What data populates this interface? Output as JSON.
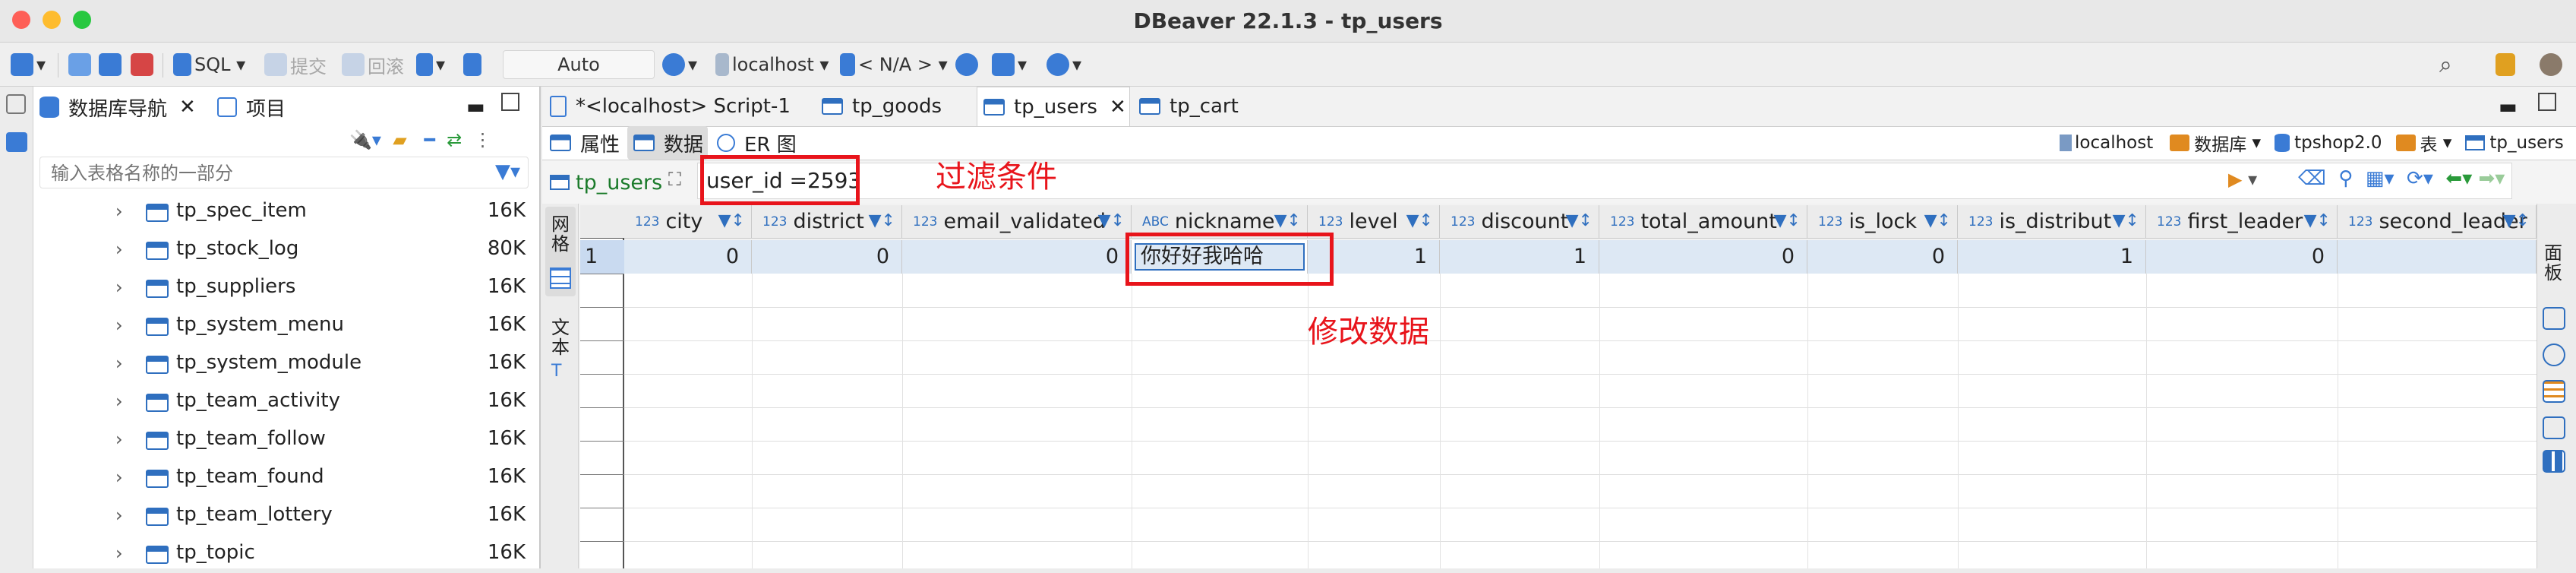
{
  "window": {
    "title": "DBeaver 22.1.3 - tp_users"
  },
  "toolbar": {
    "sql_label": "SQL",
    "commit_label": "提交",
    "rollback_label": "回滚",
    "transaction_mode": "Auto",
    "datasource": "localhost",
    "schema": "< N/A >"
  },
  "navigator": {
    "tabs": [
      {
        "label": "数据库导航"
      },
      {
        "label": "项目"
      }
    ],
    "filter_placeholder": "输入表格名称的一部分",
    "tables": [
      {
        "name": "tp_spec_item",
        "size": "16K"
      },
      {
        "name": "tp_stock_log",
        "size": "80K"
      },
      {
        "name": "tp_suppliers",
        "size": "16K"
      },
      {
        "name": "tp_system_menu",
        "size": "16K"
      },
      {
        "name": "tp_system_module",
        "size": "16K"
      },
      {
        "name": "tp_team_activity",
        "size": "16K"
      },
      {
        "name": "tp_team_follow",
        "size": "16K"
      },
      {
        "name": "tp_team_found",
        "size": "16K"
      },
      {
        "name": "tp_team_lottery",
        "size": "16K"
      },
      {
        "name": "tp_topic",
        "size": "16K"
      }
    ]
  },
  "editor": {
    "tabs": [
      {
        "label": "*<localhost> Script-1"
      },
      {
        "label": "tp_goods"
      },
      {
        "label": "tp_users"
      },
      {
        "label": "tp_cart"
      }
    ],
    "subtabs": [
      {
        "label": "属性"
      },
      {
        "label": "数据"
      },
      {
        "label": "ER 图"
      }
    ],
    "breadcrumb": {
      "datasource": "localhost",
      "database_label": "数据库",
      "database": "tpshop2.0",
      "table_label": "表",
      "table": "tp_users"
    },
    "table_name": "tp_users",
    "filter_value": "user_id =2593",
    "side_tabs": {
      "grid": "网格",
      "text": "文本",
      "panel": "面板"
    }
  },
  "grid": {
    "columns": [
      {
        "type": "123",
        "name": "city"
      },
      {
        "type": "123",
        "name": "district"
      },
      {
        "type": "123",
        "name": "email_validated"
      },
      {
        "type": "ABC",
        "name": "nickname"
      },
      {
        "type": "123",
        "name": "level"
      },
      {
        "type": "123",
        "name": "discount"
      },
      {
        "type": "123",
        "name": "total_amount"
      },
      {
        "type": "123",
        "name": "is_lock"
      },
      {
        "type": "123",
        "name": "is_distribut"
      },
      {
        "type": "123",
        "name": "first_leader"
      },
      {
        "type": "123",
        "name": "second_leader"
      }
    ],
    "row_number": "1",
    "row": [
      "0",
      "0",
      "0",
      "你好好我哈哈",
      "1",
      "1",
      "0",
      "0",
      "1",
      "0",
      ""
    ]
  },
  "annotations": {
    "filter_note": "过滤条件",
    "edit_note": "修改数据",
    "color": "#e8141b"
  }
}
